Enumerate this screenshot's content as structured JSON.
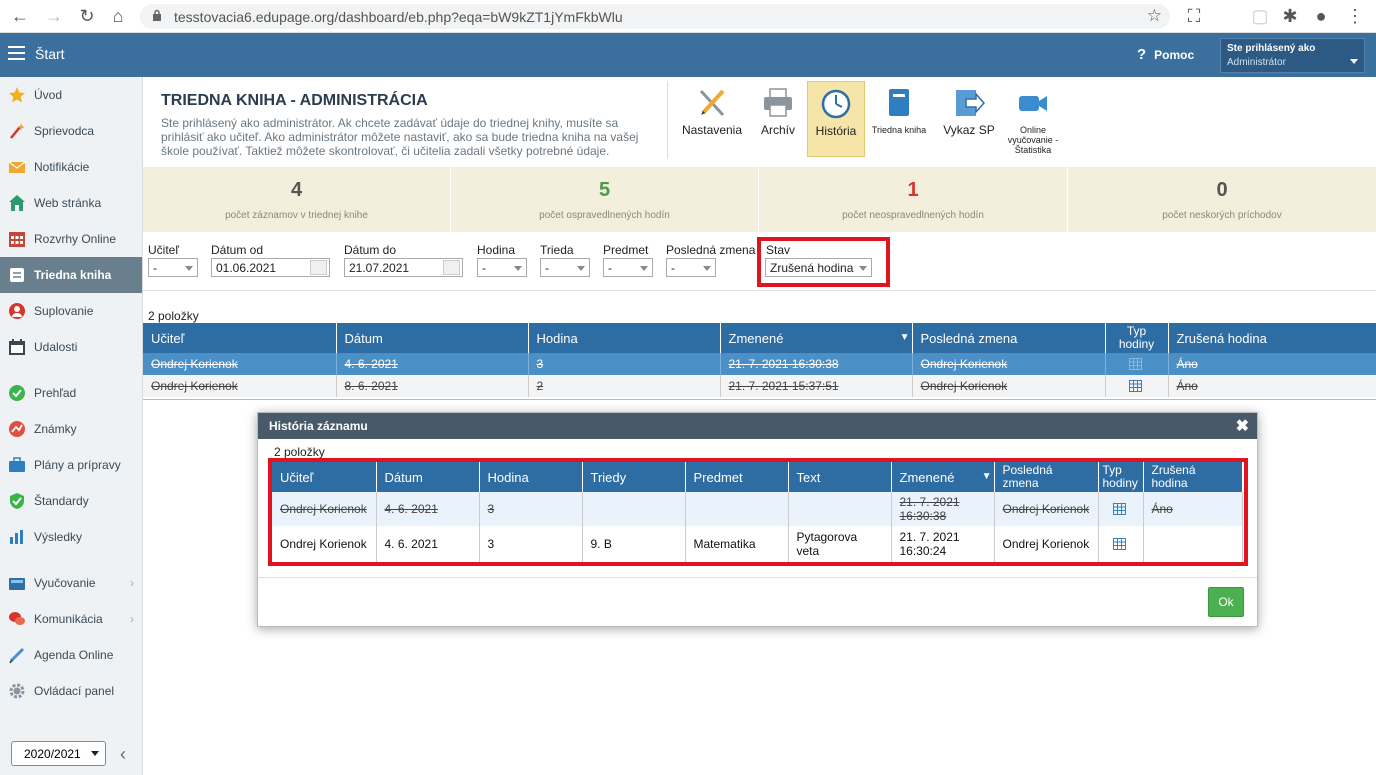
{
  "browser": {
    "url": "tesstovacia6.edupage.org/dashboard/eb.php?eqa=bW9kZT1jYmFkbWlu"
  },
  "header": {
    "title": "Štart",
    "help": "Pomoc",
    "user_line1": "Ste prihlásený ako",
    "user_line2": "Administrátor"
  },
  "sidebar": {
    "items": [
      {
        "label": "Úvod",
        "icon": "star-icon"
      },
      {
        "label": "Sprievodca",
        "icon": "wizard-icon"
      },
      {
        "label": "Notifikácie",
        "icon": "envelope-icon"
      },
      {
        "label": "Web stránka",
        "icon": "home-icon"
      },
      {
        "label": "Rozvrhy Online",
        "icon": "timetable-icon"
      },
      {
        "label": "Triedna kniha",
        "icon": "book-icon"
      },
      {
        "label": "Suplovanie",
        "icon": "substitution-icon"
      },
      {
        "label": "Udalosti",
        "icon": "calendar-icon"
      },
      {
        "label": "Prehľad",
        "icon": "check-icon"
      },
      {
        "label": "Známky",
        "icon": "grades-icon"
      },
      {
        "label": "Plány a prípravy",
        "icon": "briefcase-icon"
      },
      {
        "label": "Štandardy",
        "icon": "shield-icon"
      },
      {
        "label": "Výsledky",
        "icon": "barchart-icon"
      },
      {
        "label": "Vyučovanie",
        "icon": "teaching-icon"
      },
      {
        "label": "Komunikácia",
        "icon": "chat-icon"
      },
      {
        "label": "Agenda Online",
        "icon": "pencil-icon"
      },
      {
        "label": "Ovládací panel",
        "icon": "gear-icon"
      }
    ],
    "year": "2020/2021"
  },
  "page": {
    "title": "TRIEDNA KNIHA - ADMINISTRÁCIA",
    "description": "Ste prihlásený ako administrátor. Ak chcete zadávať údaje do triednej knihy, musíte sa prihlásiť ako učiteľ. Ako administrátor môžete nastaviť, ako sa bude triedna kniha na vašej škole používať. Taktiež môžete skontrolovať, či učitelia zadali všetky potrebné údaje."
  },
  "toolbar": {
    "nastavenia": "Nastavenia",
    "archiv": "Archív",
    "historia": "História",
    "triedna_kniha": "Triedna kniha",
    "vykaz": "Vykaz SP",
    "online": "Online vyučovanie - Štatistika"
  },
  "stats": [
    {
      "value": "4",
      "label": "počet záznamov v triednej knihe",
      "color": "#555555"
    },
    {
      "value": "5",
      "label": "počet ospravedlnených hodín",
      "color": "#4a9a4a"
    },
    {
      "value": "1",
      "label": "počet neospravedlnených hodín",
      "color": "#d9342b"
    },
    {
      "value": "0",
      "label": "počet neskorých príchodov",
      "color": "#555555"
    }
  ],
  "filters": {
    "ucitel_label": "Učiteľ",
    "ucitel_value": "-",
    "datum_od_label": "Dátum od",
    "datum_od_value": "01.06.2021",
    "datum_do_label": "Dátum do",
    "datum_do_value": "21.07.2021",
    "hodina_label": "Hodina",
    "hodina_value": "-",
    "trieda_label": "Trieda",
    "trieda_value": "-",
    "predmet_label": "Predmet",
    "predmet_value": "-",
    "posledna_label": "Posledná zmena",
    "posledna_value": "-",
    "stav_label": "Stav",
    "stav_value": "Zrušená hodina"
  },
  "main_table": {
    "count": "2 položky",
    "headers": [
      "Učiteľ",
      "Dátum",
      "Hodina",
      "Zmenené",
      "Posledná zmena",
      "Typ hodiny",
      "Zrušená hodina"
    ],
    "rows": [
      [
        "Ondrej Korienok",
        "4. 6. 2021",
        "3",
        "21. 7. 2021 16:30:38",
        "Ondrej Korienok",
        "",
        "Áno"
      ],
      [
        "Ondrej Korienok",
        "8. 6. 2021",
        "2",
        "21. 7. 2021 15:37:51",
        "Ondrej Korienok",
        "",
        "Áno"
      ]
    ]
  },
  "modal": {
    "title": "História záznamu",
    "count": "2 položky",
    "headers": [
      "Učiteľ",
      "Dátum",
      "Hodina",
      "Triedy",
      "Predmet",
      "Text",
      "Zmenené",
      "Posledná zmena",
      "Typ hodiny",
      "Zrušená hodina"
    ],
    "rows": [
      [
        "Ondrej Korienok",
        "4. 6. 2021",
        "3",
        "",
        "",
        "",
        "21. 7. 2021 16:30:38",
        "Ondrej Korienok",
        "",
        "Áno"
      ],
      [
        "Ondrej Korienok",
        "4. 6. 2021",
        "3",
        "9. B",
        "Matematika",
        "Pytagorova veta",
        "21. 7. 2021 16:30:24",
        "Ondrej Korienok",
        "",
        ""
      ]
    ],
    "ok": "Ok"
  }
}
